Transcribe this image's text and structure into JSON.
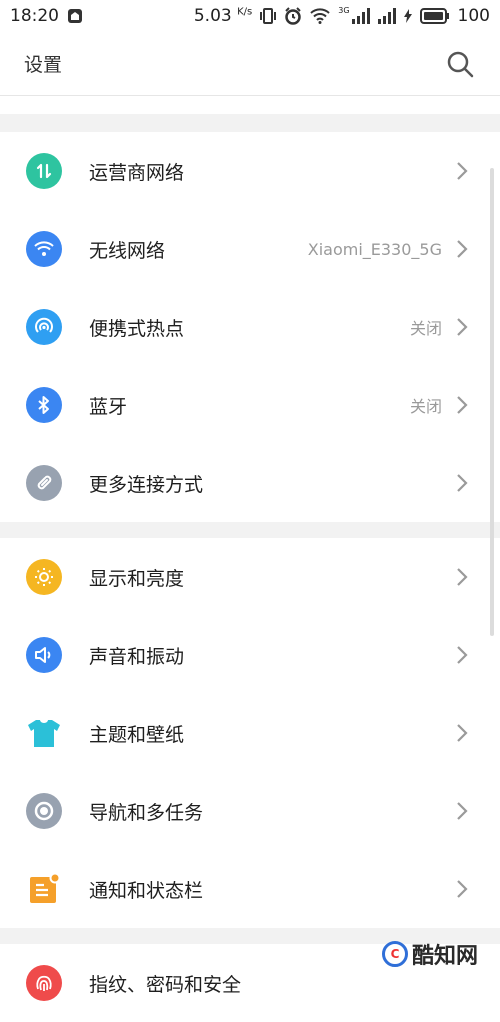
{
  "status_bar": {
    "time": "18:20",
    "speed_value": "5.03",
    "speed_unit": "K/s",
    "network_type": "3G",
    "battery": "100"
  },
  "header": {
    "title": "设置"
  },
  "groups": [
    {
      "items": [
        {
          "label": "运营商网络",
          "value": "",
          "icon": "carrier-network-icon",
          "color": "#2ec4a0"
        },
        {
          "label": "无线网络",
          "value": "Xiaomi_E330_5G",
          "icon": "wifi-icon",
          "color": "#3b86f2"
        },
        {
          "label": "便携式热点",
          "value": "关闭",
          "icon": "hotspot-icon",
          "color": "#2f9ff2"
        },
        {
          "label": "蓝牙",
          "value": "关闭",
          "icon": "bluetooth-icon",
          "color": "#3b86f2"
        },
        {
          "label": "更多连接方式",
          "value": "",
          "icon": "link-icon",
          "color": "#98a2b0"
        }
      ]
    },
    {
      "items": [
        {
          "label": "显示和亮度",
          "value": "",
          "icon": "brightness-icon",
          "color": "#f5b622"
        },
        {
          "label": "声音和振动",
          "value": "",
          "icon": "sound-icon",
          "color": "#3b86f2"
        },
        {
          "label": "主题和壁纸",
          "value": "",
          "icon": "theme-shirt-icon",
          "color": "#2bc0d8"
        },
        {
          "label": "导航和多任务",
          "value": "",
          "icon": "navigation-icon",
          "color": "#98a2b0"
        },
        {
          "label": "通知和状态栏",
          "value": "",
          "icon": "notification-icon",
          "color": "#f5a02a"
        }
      ]
    },
    {
      "items": [
        {
          "label": "指纹、密码和安全",
          "value": "",
          "icon": "fingerprint-icon",
          "color": "#ef4b4b"
        }
      ]
    }
  ],
  "watermark": {
    "text": "酷知网"
  }
}
